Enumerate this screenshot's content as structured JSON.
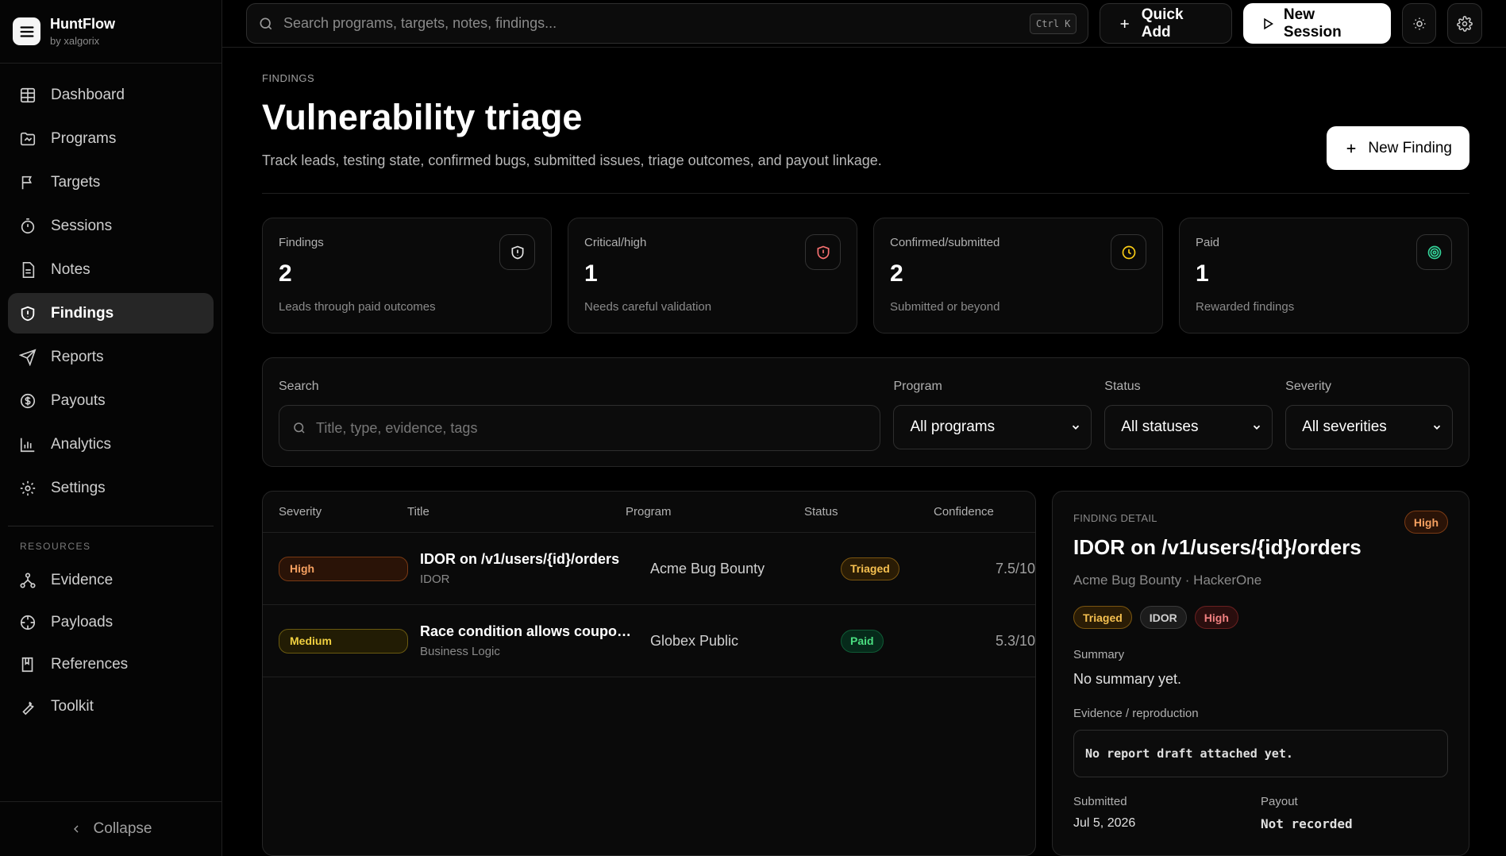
{
  "brand": {
    "name": "HuntFlow",
    "sub": "by xalgorix"
  },
  "nav": [
    {
      "label": "Dashboard",
      "icon": "grid-icon"
    },
    {
      "label": "Programs",
      "icon": "folder-icon"
    },
    {
      "label": "Targets",
      "icon": "flag-icon"
    },
    {
      "label": "Sessions",
      "icon": "timer-icon"
    },
    {
      "label": "Notes",
      "icon": "file-icon"
    },
    {
      "label": "Findings",
      "icon": "shield-icon",
      "active": true
    },
    {
      "label": "Reports",
      "icon": "send-icon"
    },
    {
      "label": "Payouts",
      "icon": "dollar-icon"
    },
    {
      "label": "Analytics",
      "icon": "bar-chart-icon"
    },
    {
      "label": "Settings",
      "icon": "gear-icon"
    }
  ],
  "resources": {
    "label": "RESOURCES",
    "items": [
      {
        "label": "Evidence",
        "icon": "network-icon"
      },
      {
        "label": "Payloads",
        "icon": "crosshair-icon"
      },
      {
        "label": "References",
        "icon": "book-icon"
      },
      {
        "label": "Toolkit",
        "icon": "wrench-icon"
      }
    ]
  },
  "collapse_label": "Collapse",
  "topbar": {
    "search_placeholder": "Search programs, targets, notes, findings...",
    "shortcut": "Ctrl K",
    "quick_add": "Quick Add",
    "new_session": "New Session"
  },
  "page": {
    "crumb": "FINDINGS",
    "title": "Vulnerability triage",
    "description": "Track leads, testing state, confirmed bugs, submitted issues, triage outcomes, and payout linkage.",
    "new_finding": "New Finding"
  },
  "stats": [
    {
      "label": "Findings",
      "value": "2",
      "sub": "Leads through paid outcomes",
      "icon": "shield-icon",
      "color": "#e5e5e5"
    },
    {
      "label": "Critical/high",
      "value": "1",
      "sub": "Needs careful validation",
      "icon": "shield-alert-icon",
      "color": "#f87171"
    },
    {
      "label": "Confirmed/submitted",
      "value": "2",
      "sub": "Submitted or beyond",
      "icon": "clock-icon",
      "color": "#facc15"
    },
    {
      "label": "Paid",
      "value": "1",
      "sub": "Rewarded findings",
      "icon": "target-icon",
      "color": "#34d399"
    }
  ],
  "filters": {
    "search_label": "Search",
    "search_placeholder": "Title, type, evidence, tags",
    "program_label": "Program",
    "program_value": "All programs",
    "status_label": "Status",
    "status_value": "All statuses",
    "severity_label": "Severity",
    "severity_value": "All severities"
  },
  "table": {
    "headers": {
      "severity": "Severity",
      "title": "Title",
      "program": "Program",
      "status": "Status",
      "confidence": "Confidence"
    },
    "rows": [
      {
        "severity": "High",
        "title": "IDOR on /v1/users/{id}/orders",
        "type": "IDOR",
        "program": "Acme Bug Bounty",
        "status": "Triaged",
        "confidence": "7.5/10"
      },
      {
        "severity": "Medium",
        "title": "Race condition allows coupon st...",
        "type": "Business Logic",
        "program": "Globex Public",
        "status": "Paid",
        "confidence": "5.3/10"
      }
    ]
  },
  "detail": {
    "label": "FINDING DETAIL",
    "severity": "High",
    "title": "IDOR on /v1/users/{id}/orders",
    "subtitle": "Acme Bug Bounty · HackerOne",
    "tags": [
      "Triaged",
      "IDOR",
      "High"
    ],
    "summary_label": "Summary",
    "summary": "No summary yet.",
    "evidence_label": "Evidence / reproduction",
    "evidence": "No report draft attached yet.",
    "submitted_label": "Submitted",
    "submitted_value": "Jul 5, 2026",
    "payout_label": "Payout",
    "payout_value": "Not recorded"
  }
}
